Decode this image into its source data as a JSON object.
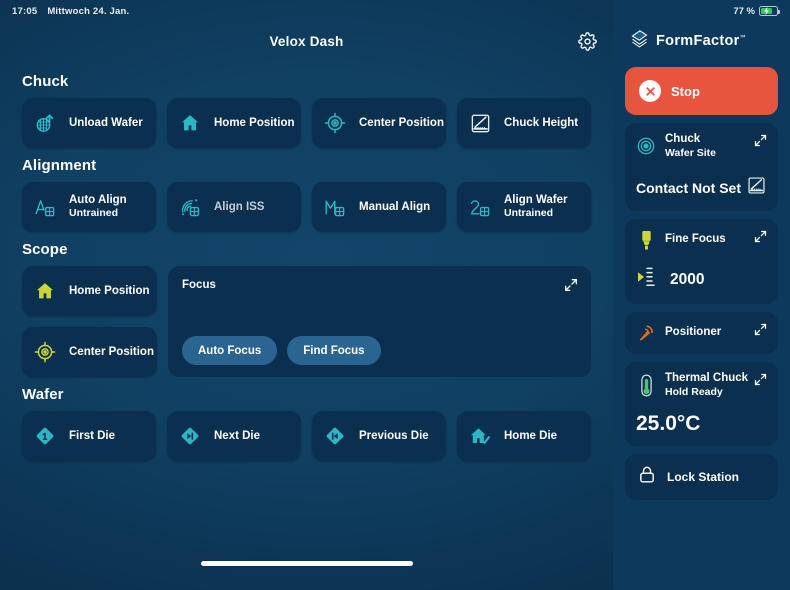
{
  "status_bar": {
    "time": "17:05",
    "date": "Mittwoch 24. Jan.",
    "battery_percent": "77 %",
    "battery_icon": "battery-charging-icon"
  },
  "header": {
    "title": "Velox Dash",
    "settings_icon": "gear-icon"
  },
  "sections": [
    {
      "title": "Chuck",
      "tiles": [
        {
          "label": "Unload Wafer",
          "sub": "",
          "icon": "wafer-unload-icon",
          "color": "#2bb7c4"
        },
        {
          "label": "Home Position",
          "sub": "",
          "icon": "home-icon",
          "color": "#2bb7c4"
        },
        {
          "label": "Center Position",
          "sub": "",
          "icon": "crosshair-target-icon",
          "color": "#2bb7c4"
        },
        {
          "label": "Chuck Height",
          "sub": "",
          "icon": "height-gauge-icon",
          "color": "#e6eef5"
        }
      ]
    },
    {
      "title": "Alignment",
      "tiles": [
        {
          "label": "Auto Align",
          "sub": "Untrained",
          "icon": "auto-align-icon",
          "color": "#2bb7c4"
        },
        {
          "label": "Align ISS",
          "sub": "",
          "icon": "align-iss-icon",
          "color": "#2bb7c4"
        },
        {
          "label": "Manual Align",
          "sub": "",
          "icon": "manual-align-icon",
          "color": "#2bb7c4"
        },
        {
          "label": "Align Wafer",
          "sub": "Untrained",
          "icon": "align-wafer-icon",
          "color": "#2bb7c4"
        }
      ]
    },
    {
      "title": "Scope",
      "tiles": [
        {
          "label": "Home Position",
          "sub": "",
          "icon": "home-icon",
          "color": "#ccd63a"
        },
        {
          "label": "Center Position",
          "sub": "",
          "icon": "crosshair-target-icon",
          "color": "#ccd63a"
        }
      ]
    },
    {
      "title": "Wafer",
      "tiles": [
        {
          "label": "First Die",
          "sub": "",
          "icon": "first-die-icon",
          "color": "#2bb7c4"
        },
        {
          "label": "Next Die",
          "sub": "",
          "icon": "next-die-icon",
          "color": "#2bb7c4"
        },
        {
          "label": "Previous Die",
          "sub": "",
          "icon": "previous-die-icon",
          "color": "#2bb7c4"
        },
        {
          "label": "Home Die",
          "sub": "",
          "icon": "home-die-icon",
          "color": "#2bb7c4"
        }
      ]
    }
  ],
  "focus_card": {
    "title": "Focus",
    "expand_icon": "expand-arrows-icon",
    "buttons": [
      {
        "label": "Auto Focus"
      },
      {
        "label": "Find Focus"
      }
    ]
  },
  "sidebar": {
    "brand": "FormFactor",
    "brand_tm": "™",
    "brand_icon": "formfactor-logo-icon",
    "stop": {
      "label": "Stop",
      "icon": "stop-x-icon",
      "color": "#e8553f"
    },
    "chuck_card": {
      "title": "Chuck",
      "subtitle": "Wafer Site",
      "icon": "concentric-target-icon",
      "expand_icon": "expand-arrows-icon",
      "contact_text": "Contact Not Set",
      "contact_icon": "height-gauge-icon"
    },
    "fine_focus_card": {
      "title": "Fine Focus",
      "icon": "objective-lens-icon",
      "expand_icon": "expand-arrows-icon",
      "value": "2000",
      "marker_icon": "focus-scale-icon",
      "accent": "#ccd63a"
    },
    "positioner_card": {
      "title": "Positioner",
      "icon": "positioner-probe-icon",
      "expand_icon": "expand-arrows-icon",
      "accent": "#ef6c1f"
    },
    "thermal_card": {
      "title": "Thermal Chuck",
      "subtitle": "Hold Ready",
      "icon": "thermometer-icon",
      "expand_icon": "expand-arrows-icon",
      "temperature": "25.0°C",
      "accent": "#4cc46a"
    },
    "lock_station": {
      "label": "Lock Station",
      "icon": "padlock-icon"
    }
  }
}
